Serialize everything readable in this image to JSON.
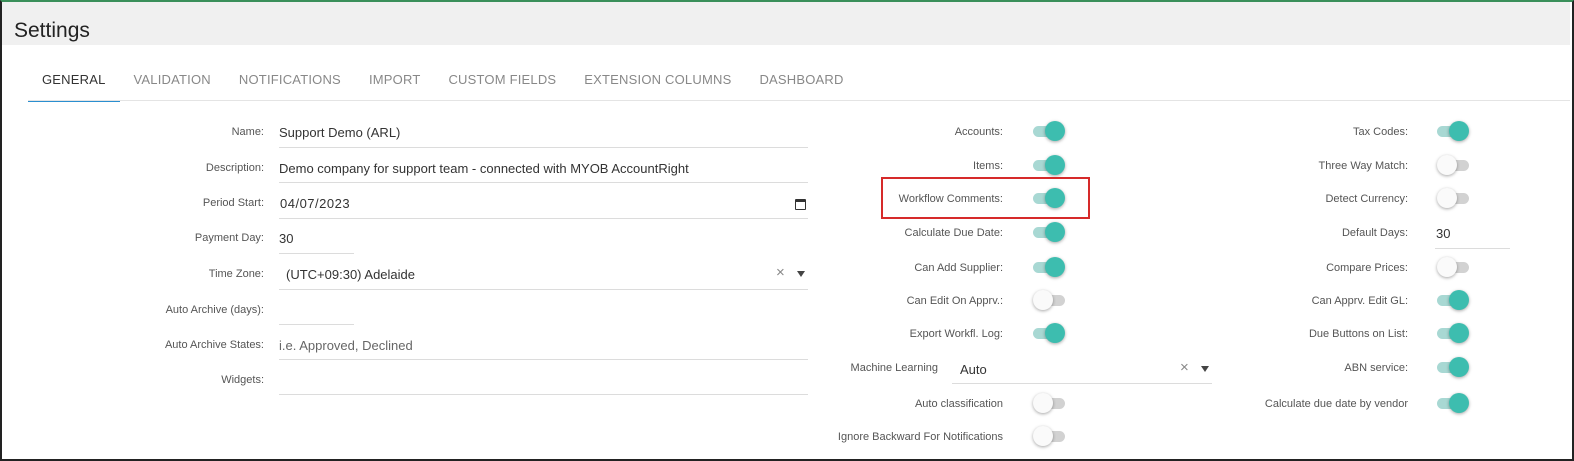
{
  "page": {
    "title": "Settings"
  },
  "tabs": [
    {
      "label": "GENERAL",
      "active": true
    },
    {
      "label": "VALIDATION",
      "active": false
    },
    {
      "label": "NOTIFICATIONS",
      "active": false
    },
    {
      "label": "IMPORT",
      "active": false
    },
    {
      "label": "CUSTOM FIELDS",
      "active": false
    },
    {
      "label": "EXTENSION COLUMNS",
      "active": false
    },
    {
      "label": "DASHBOARD",
      "active": false
    }
  ],
  "left": {
    "name": {
      "label": "Name:",
      "value": "Support Demo (ARL)"
    },
    "description": {
      "label": "Description:",
      "value": "Demo company for support team - connected with MYOB AccountRight"
    },
    "period_start": {
      "label": "Period Start:",
      "value": "04/07/2023"
    },
    "payment_day": {
      "label": "Payment Day:",
      "value": "30"
    },
    "time_zone": {
      "label": "Time Zone:",
      "value": "(UTC+09:30) Adelaide"
    },
    "auto_archive_days": {
      "label": "Auto Archive (days):",
      "value": ""
    },
    "auto_archive_states": {
      "label": "Auto Archive States:",
      "placeholder": "i.e. Approved, Declined"
    },
    "widgets": {
      "label": "Widgets:",
      "value": ""
    }
  },
  "middle": {
    "accounts": {
      "label": "Accounts:",
      "on": true
    },
    "items": {
      "label": "Items:",
      "on": true
    },
    "workflow_comments": {
      "label": "Workflow Comments:",
      "on": true
    },
    "calculate_due_date": {
      "label": "Calculate Due Date:",
      "on": true
    },
    "can_add_supplier": {
      "label": "Can Add Supplier:",
      "on": true
    },
    "can_edit_on_apprv": {
      "label": "Can Edit On Apprv.:",
      "on": false
    },
    "export_workfl_log": {
      "label": "Export Workfl. Log:",
      "on": true
    },
    "machine_learning": {
      "label": "Machine Learning",
      "value": "Auto"
    },
    "auto_classification": {
      "label": "Auto classification",
      "on": false
    },
    "ignore_backward": {
      "label": "Ignore Backward For Notifications",
      "on": false
    }
  },
  "right": {
    "tax_codes": {
      "label": "Tax Codes:",
      "on": true
    },
    "three_way_match": {
      "label": "Three Way Match:",
      "on": false
    },
    "detect_currency": {
      "label": "Detect Currency:",
      "on": false
    },
    "default_days": {
      "label": "Default Days:",
      "value": "30"
    },
    "compare_prices": {
      "label": "Compare Prices:",
      "on": false
    },
    "can_apprv_edit_gl": {
      "label": "Can Apprv. Edit GL:",
      "on": true
    },
    "due_buttons_on_list": {
      "label": "Due Buttons on List:",
      "on": true
    },
    "abn_service": {
      "label": "ABN service:",
      "on": true
    },
    "calc_due_by_vendor": {
      "label": "Calculate due date by vendor",
      "on": true
    }
  },
  "icons": {
    "clear": "×",
    "dropdown": "caret-down-icon",
    "calendar": "calendar-icon"
  },
  "colors": {
    "toggle_on": "#3dbdaf",
    "tab_active_underline": "#2a8fd0",
    "highlight": "#d62a2a"
  }
}
